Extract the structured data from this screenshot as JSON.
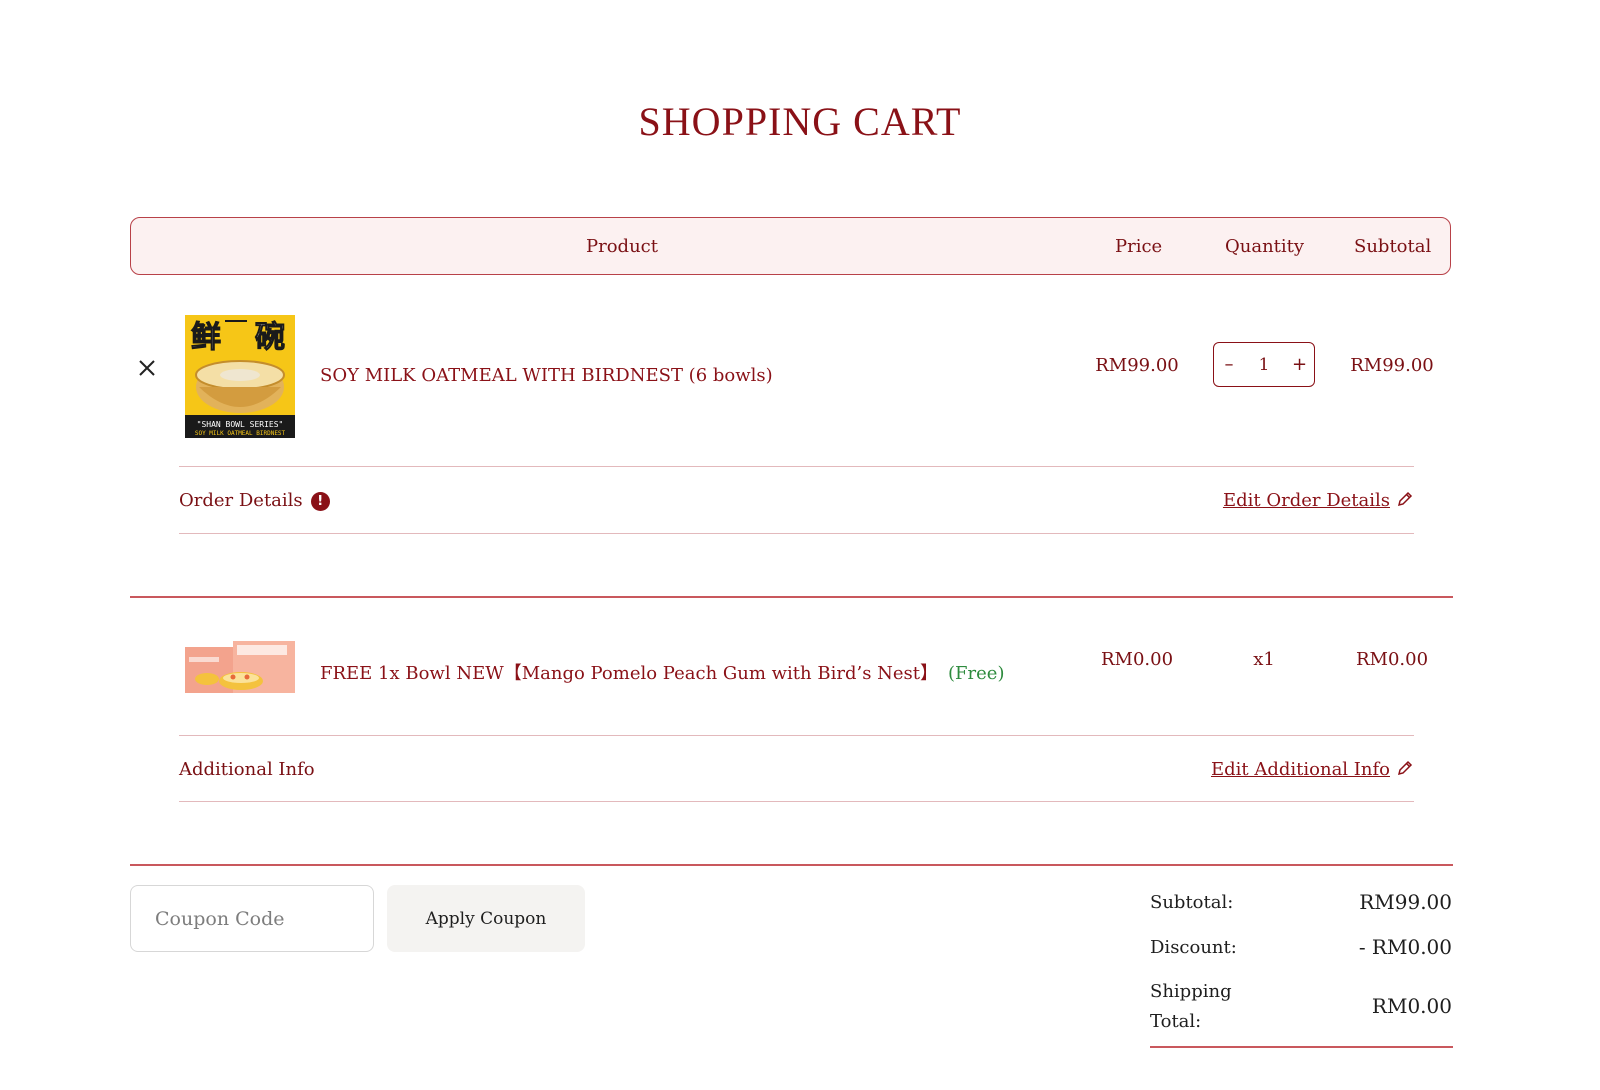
{
  "page": {
    "title": "SHOPPING CART"
  },
  "table_header": {
    "product": "Product",
    "price": "Price",
    "quantity": "Quantity",
    "subtotal": "Subtotal"
  },
  "items": [
    {
      "name": "SOY MILK OATMEAL WITH BIRDNEST (6 bowls)",
      "price": "RM99.00",
      "quantity": "1",
      "subtotal": "RM99.00",
      "thumbnail_text": {
        "top": "鲜 碗",
        "banner": "\"SHAN BOWL SERIES\"",
        "subline": "SOY MILK OATMEAL BIRDNEST"
      },
      "detail_label": "Order Details",
      "detail_alert_icon": "exclamation-circle-icon",
      "edit_label": "Edit Order Details",
      "remove_icon": "close-icon"
    },
    {
      "name": "FREE 1x Bowl NEW【Mango Pomelo Peach Gum with Bird’s Nest】",
      "free_tag": "(Free)",
      "price": "RM0.00",
      "quantity": "x1",
      "subtotal": "RM0.00",
      "detail_label": "Additional Info",
      "edit_label": "Edit Additional Info"
    }
  ],
  "coupon": {
    "placeholder": "Coupon Code",
    "apply_label": "Apply Coupon"
  },
  "totals": {
    "subtotal_label": "Subtotal:",
    "subtotal_value": "RM99.00",
    "discount_label": "Discount:",
    "discount_value": "- RM0.00",
    "shipping_label_line1": "Shipping",
    "shipping_label_line2": "Total:",
    "shipping_value": "RM0.00"
  },
  "colors": {
    "brand": "#8a1117",
    "header_bg": "#fcf1f1",
    "free_green": "#2e8b3e",
    "button_bg": "#f4f3f1"
  }
}
